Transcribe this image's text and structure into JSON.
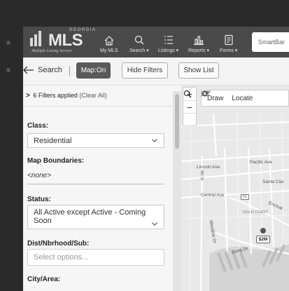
{
  "header": {
    "logo_text": "MLS",
    "logo_superscript": "GEORGIA",
    "logo_tagline": "Multiple Listing Service",
    "nav": [
      {
        "label": "My MLS",
        "icon": "home-icon"
      },
      {
        "label": "Search ▾",
        "icon": "search-icon"
      },
      {
        "label": "Listings ▾",
        "icon": "list-icon"
      },
      {
        "label": "Reports ▾",
        "icon": "bar-chart-icon"
      },
      {
        "label": "Forms ▾",
        "icon": "document-icon"
      }
    ],
    "smartbar_placeholder": "SmartBar"
  },
  "toolbar": {
    "back_label": "Search",
    "map_on_label": "Map:On",
    "hide_filters_label": "Hide Filters",
    "show_list_label": "Show List"
  },
  "filters": {
    "applied_text": "6 Filters applied",
    "clear_text": "(Clear All)",
    "class_label": "Class:",
    "class_value": "Residential",
    "map_boundaries_label": "Map Boundaries:",
    "map_boundaries_value": "<none>",
    "status_label": "Status:",
    "status_value": "All Active except Active - Coming Soon",
    "dist_label": "Dist/Nbrhood/Sub:",
    "dist_placeholder": "Select options...",
    "city_label": "City/Area:"
  },
  "map": {
    "zoom_in": "+",
    "zoom_out": "−",
    "draw_label": "Draw",
    "locate_label": "Locate",
    "labels": {
      "lincoln": "Lincoln Ave",
      "pacific": "Pacific Ave",
      "central": "Central Ave",
      "route": "61",
      "santa_clara": "Santa Clar",
      "gold_coast": "GOLD COAST",
      "encinal": "Encinal",
      "westline": "Westline Dr",
      "doris": "Doris Dr",
      "eighth": "8th St"
    },
    "price_marker": "$2M"
  },
  "colors": {
    "header_bg": "#4a4a4a",
    "active_button": "#5a5a5a",
    "map_bg": "#e9e9e9"
  }
}
